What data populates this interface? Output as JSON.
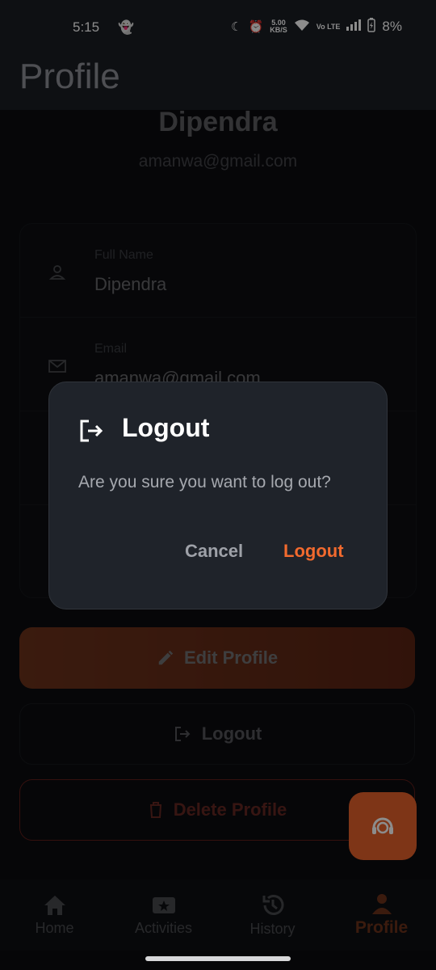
{
  "status_bar": {
    "time": "5:15",
    "speed": "5.00",
    "speed_unit": "KB/S",
    "network": "Vo LTE",
    "battery": "8%"
  },
  "page": {
    "title": "Profile"
  },
  "profile": {
    "name": "Dipendra",
    "email": "amanwa@gmail.com"
  },
  "fields": [
    {
      "label": "Full Name",
      "value": "Dipendra",
      "icon": "person-icon"
    },
    {
      "label": "Email",
      "value": "amanwa@gmail.com",
      "icon": "mail-icon"
    }
  ],
  "actions": {
    "edit": "Edit Profile",
    "logout": "Logout",
    "delete": "Delete Profile"
  },
  "bottom_nav": [
    {
      "label": "Home",
      "icon": "home-icon"
    },
    {
      "label": "Activities",
      "icon": "ticket-icon"
    },
    {
      "label": "History",
      "icon": "history-icon"
    },
    {
      "label": "Profile",
      "icon": "person-icon",
      "active": true
    }
  ],
  "dialog": {
    "title": "Logout",
    "message": "Are you sure you want to log out?",
    "cancel": "Cancel",
    "confirm": "Logout"
  },
  "colors": {
    "accent": "#f26a2e",
    "danger": "#e0503f",
    "background": "#0b0c0f"
  }
}
